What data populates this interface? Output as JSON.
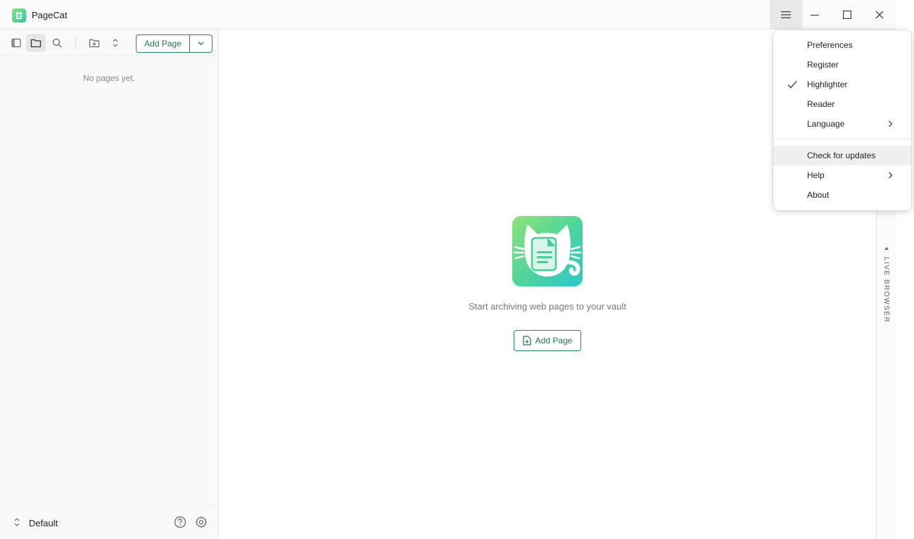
{
  "app": {
    "title": "PageCat"
  },
  "sidebar": {
    "add_page_label": "Add Page",
    "empty_text": "No pages yet.",
    "vault_name": "Default"
  },
  "main": {
    "tagline": "Start archiving web pages to your vault",
    "add_page_label": "Add Page"
  },
  "live_browser": {
    "label": "LIVE BROWSER"
  },
  "menu": {
    "items": [
      {
        "label": "Preferences",
        "checked": false,
        "submenu": false
      },
      {
        "label": "Register",
        "checked": false,
        "submenu": false
      },
      {
        "label": "Highlighter",
        "checked": true,
        "submenu": false
      },
      {
        "label": "Reader",
        "checked": false,
        "submenu": false
      },
      {
        "label": "Language",
        "checked": false,
        "submenu": true
      },
      {
        "label": "Check for updates",
        "checked": false,
        "submenu": false,
        "highlighted": true
      },
      {
        "label": "Help",
        "checked": false,
        "submenu": true
      },
      {
        "label": "About",
        "checked": false,
        "submenu": false
      }
    ]
  },
  "colors": {
    "accent": "#1f8a63",
    "brand_gradient_start": "#8fe27a",
    "brand_gradient_end": "#2cc7c9"
  },
  "icons": [
    "app-logo-icon",
    "hamburger-icon",
    "minimize-icon",
    "maximize-icon",
    "close-icon",
    "sidebar-toggle-icon",
    "folder-icon",
    "search-icon",
    "new-folder-icon",
    "sort-icon",
    "chevron-down-icon",
    "updown-icon",
    "help-icon",
    "gear-icon",
    "document-plus-icon",
    "checkmark-icon",
    "chevron-right-icon"
  ]
}
